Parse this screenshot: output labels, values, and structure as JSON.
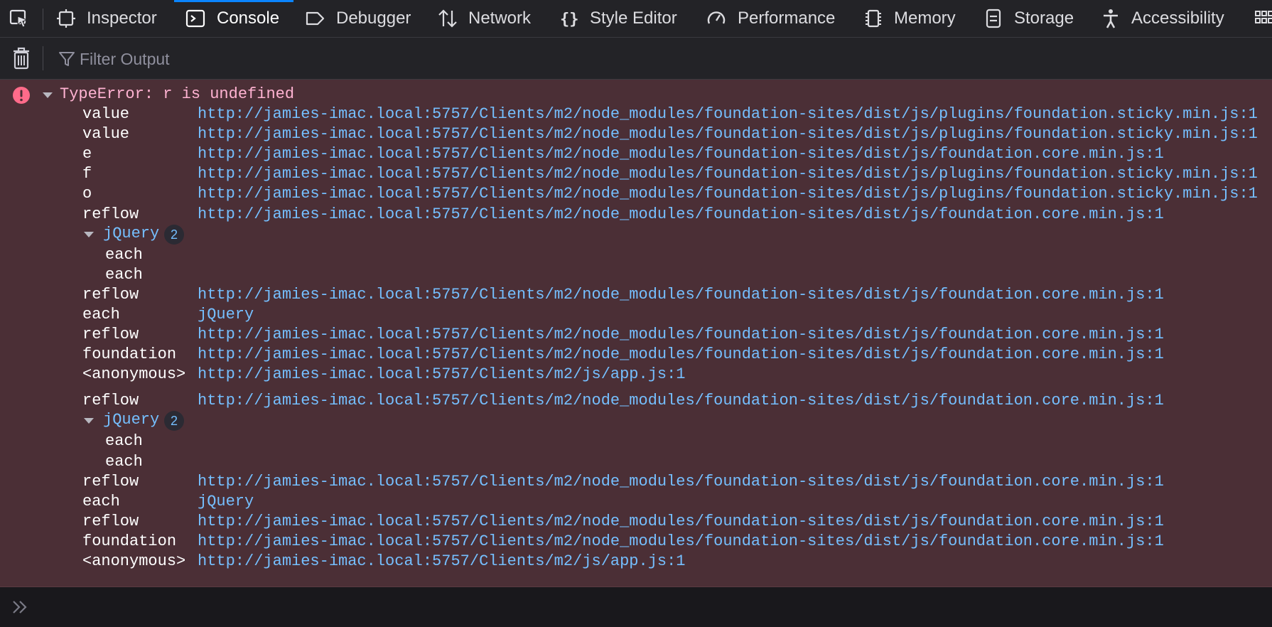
{
  "toolbar": {
    "tabs": [
      {
        "id": "inspector",
        "label": "Inspector",
        "icon": "inspector-icon"
      },
      {
        "id": "console",
        "label": "Console",
        "icon": "console-icon",
        "selected": true
      },
      {
        "id": "debugger",
        "label": "Debugger",
        "icon": "debugger-icon"
      },
      {
        "id": "network",
        "label": "Network",
        "icon": "network-icon"
      },
      {
        "id": "style-editor",
        "label": "Style Editor",
        "icon": "braces-icon"
      },
      {
        "id": "performance",
        "label": "Performance",
        "icon": "gauge-icon"
      },
      {
        "id": "memory",
        "label": "Memory",
        "icon": "memory-chip-icon"
      },
      {
        "id": "storage",
        "label": "Storage",
        "icon": "storage-icon"
      },
      {
        "id": "accessibility",
        "label": "Accessibility",
        "icon": "accessibility-icon"
      }
    ]
  },
  "filter": {
    "placeholder": "Filter Output"
  },
  "error": {
    "message": "TypeError: r is undefined",
    "stack": [
      {
        "fn": "value",
        "loc": "http://jamies-imac.local:5757/Clients/m2/node_modules/foundation-sites/dist/js/plugins/foundation.sticky.min.js:1"
      },
      {
        "fn": "value",
        "loc": "http://jamies-imac.local:5757/Clients/m2/node_modules/foundation-sites/dist/js/plugins/foundation.sticky.min.js:1"
      },
      {
        "fn": "e",
        "loc": "http://jamies-imac.local:5757/Clients/m2/node_modules/foundation-sites/dist/js/foundation.core.min.js:1"
      },
      {
        "fn": "f",
        "loc": "http://jamies-imac.local:5757/Clients/m2/node_modules/foundation-sites/dist/js/plugins/foundation.sticky.min.js:1"
      },
      {
        "fn": "o",
        "loc": "http://jamies-imac.local:5757/Clients/m2/node_modules/foundation-sites/dist/js/plugins/foundation.sticky.min.js:1"
      },
      {
        "fn": "reflow",
        "loc": "http://jamies-imac.local:5757/Clients/m2/node_modules/foundation-sites/dist/js/foundation.core.min.js:1"
      }
    ],
    "group1": {
      "label": "jQuery",
      "count": "2",
      "items": [
        "each",
        "each"
      ]
    },
    "stack2": [
      {
        "fn": "reflow",
        "loc": "http://jamies-imac.local:5757/Clients/m2/node_modules/foundation-sites/dist/js/foundation.core.min.js:1"
      },
      {
        "fn": "each",
        "loc": "jQuery"
      },
      {
        "fn": "reflow",
        "loc": "http://jamies-imac.local:5757/Clients/m2/node_modules/foundation-sites/dist/js/foundation.core.min.js:1"
      },
      {
        "fn": "foundation",
        "loc": "http://jamies-imac.local:5757/Clients/m2/node_modules/foundation-sites/dist/js/foundation.core.min.js:1"
      },
      {
        "fn": "<anonymous>",
        "loc": "http://jamies-imac.local:5757/Clients/m2/js/app.js:1"
      }
    ],
    "stack3": [
      {
        "fn": "reflow",
        "loc": "http://jamies-imac.local:5757/Clients/m2/node_modules/foundation-sites/dist/js/foundation.core.min.js:1"
      }
    ],
    "group2": {
      "label": "jQuery",
      "count": "2",
      "items": [
        "each",
        "each"
      ]
    },
    "stack4": [
      {
        "fn": "reflow",
        "loc": "http://jamies-imac.local:5757/Clients/m2/node_modules/foundation-sites/dist/js/foundation.core.min.js:1"
      },
      {
        "fn": "each",
        "loc": "jQuery"
      },
      {
        "fn": "reflow",
        "loc": "http://jamies-imac.local:5757/Clients/m2/node_modules/foundation-sites/dist/js/foundation.core.min.js:1"
      },
      {
        "fn": "foundation",
        "loc": "http://jamies-imac.local:5757/Clients/m2/node_modules/foundation-sites/dist/js/foundation.core.min.js:1"
      },
      {
        "fn": "<anonymous>",
        "loc": "http://jamies-imac.local:5757/Clients/m2/js/app.js:1"
      }
    ]
  },
  "colors": {
    "error_bg": "#4b2f36",
    "error_text": "#ffb3d2",
    "link": "#75bfff",
    "accent": "#0a84ff"
  }
}
